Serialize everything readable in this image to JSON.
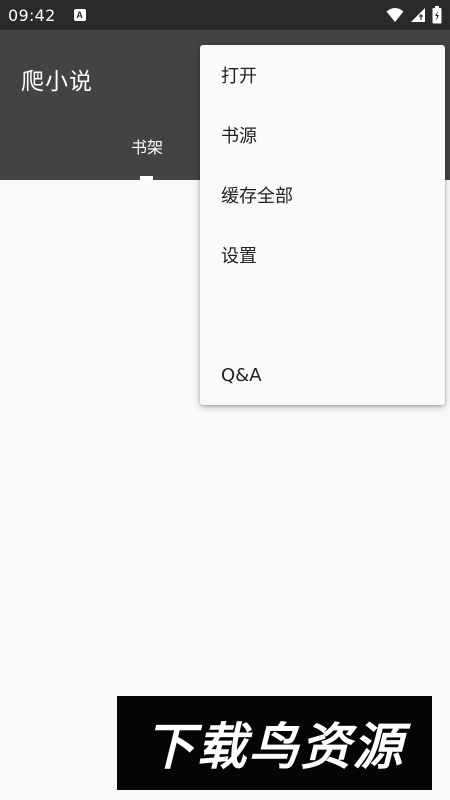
{
  "status_bar": {
    "time": "09:42",
    "notification_icon_letter": "A",
    "icons": [
      "wifi-icon",
      "cell-signal-icon",
      "battery-icon"
    ]
  },
  "app_bar": {
    "title": "爬小说",
    "background_color": "#434343",
    "tabs": [
      {
        "label": "书架",
        "selected": true
      }
    ]
  },
  "overflow_menu": {
    "items": [
      {
        "label": "打开"
      },
      {
        "label": "书源"
      },
      {
        "label": "缓存全部"
      },
      {
        "label": "设置"
      },
      {
        "label": ""
      },
      {
        "label": "Q&A"
      }
    ]
  },
  "watermark": {
    "text": "下载鸟资源"
  }
}
